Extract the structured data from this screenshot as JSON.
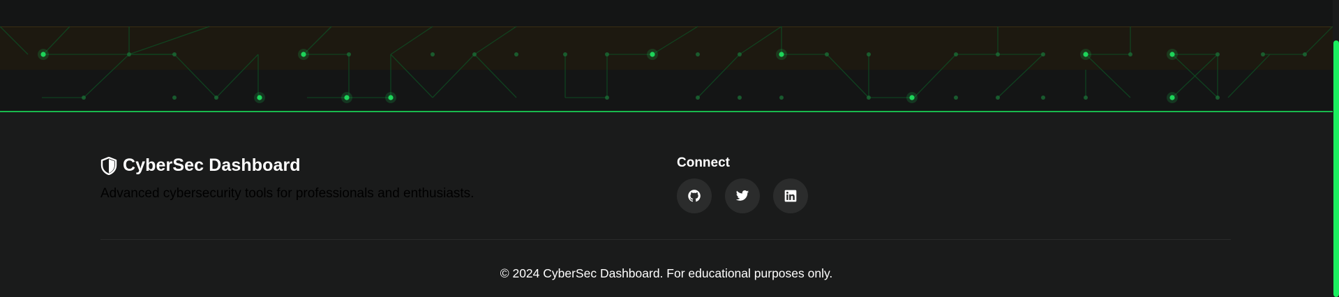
{
  "colors": {
    "accent": "#1bf060",
    "background": "#1a1b1b",
    "banner_background": "#141515",
    "circuit_line": "#0f4a22",
    "circuit_node": "#1ed45a",
    "banner_highlight_band": "#1e1a10",
    "icon_button_bg": "#2b2c2c"
  },
  "footer": {
    "brand": {
      "icon": "shield-half-icon",
      "title": "CyberSec Dashboard",
      "description": "Advanced cybersecurity tools for professionals and enthusiasts."
    },
    "connect": {
      "title": "Connect",
      "links": [
        {
          "icon": "github-icon",
          "label": "GitHub"
        },
        {
          "icon": "twitter-icon",
          "label": "Twitter"
        },
        {
          "icon": "linkedin-icon",
          "label": "LinkedIn"
        }
      ]
    },
    "copyright": "© 2024 CyberSec Dashboard. For educational purposes only."
  }
}
